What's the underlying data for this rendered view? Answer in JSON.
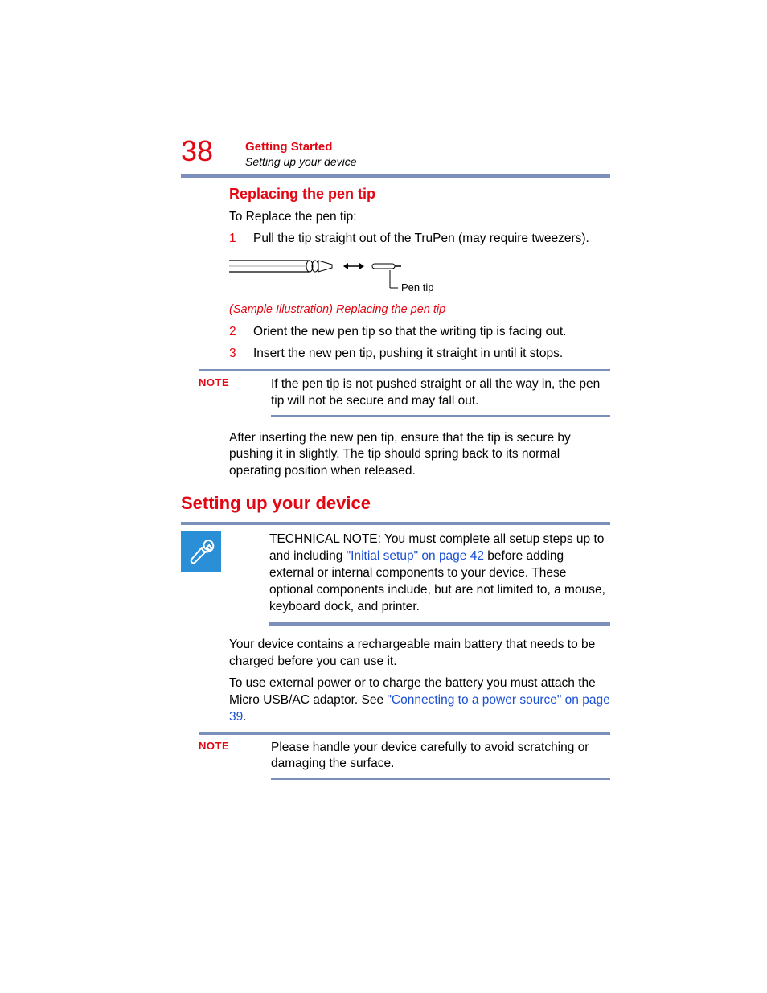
{
  "page_number": "38",
  "chapter_title": "Getting Started",
  "running_head": "Setting up your device",
  "sub_heading_1": "Replacing the pen tip",
  "intro_1": "To Replace the pen tip:",
  "steps": [
    {
      "num": "1",
      "text": "Pull the tip straight out of the TruPen (may require tweezers)."
    },
    {
      "num": "2",
      "text": "Orient the new pen tip so that the writing tip is facing out."
    },
    {
      "num": "3",
      "text": "Insert the new pen tip, pushing it straight in until it stops."
    }
  ],
  "figure_label": "Pen tip",
  "figure_caption": "(Sample Illustration) Replacing the pen tip",
  "note_label": "NOTE",
  "note1_text": "If the pen tip is not pushed straight or all the way in, the pen tip will not be secure and may fall out.",
  "after_note_text": "After inserting the new pen tip, ensure that the tip is secure by pushing it in slightly. The tip should spring back to its normal operating position when released.",
  "main_heading_2": "Setting up your device",
  "tech_pre": "TECHNICAL NOTE: You must complete all setup steps up to and including ",
  "tech_link": "\"Initial setup\" on page 42",
  "tech_post": " before adding external or internal components to your device. These optional components include, but are not limited to, a mouse, keyboard dock, and printer.",
  "body2": "Your device contains a rechargeable main battery that needs to be charged before you can use it.",
  "body3_pre": "To use external power or to charge the battery you must attach the Micro USB/AC adaptor. See ",
  "body3_link": "\"Connecting to a power source\" on page 39",
  "body3_post": ".",
  "note2_text": "Please handle your device carefully to avoid scratching or damaging the surface."
}
